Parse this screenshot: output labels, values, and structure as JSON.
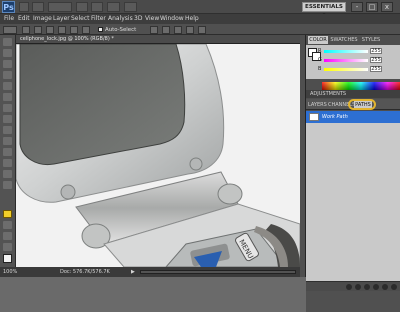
{
  "app": {
    "logo_text": "Ps",
    "workspace_label": "ESSENTIALS ▾",
    "window_controls": [
      "-",
      "□",
      "x"
    ]
  },
  "menu": [
    "File",
    "Edit",
    "Image",
    "Layer",
    "Select",
    "Filter",
    "Analysis",
    "3D",
    "View",
    "Window",
    "Help"
  ],
  "options_bar": {
    "auto_select_label": "Auto-Select"
  },
  "document": {
    "tab_title": "cellphone_lock.jpg @ 100% (RGB/8) *"
  },
  "status_bar": {
    "zoom": "100%",
    "doc_info": "Doc: 576.7K/576.7K",
    "nav_arrow": "▶"
  },
  "panels": {
    "color_tabs": [
      "COLOR",
      "SWATCHES",
      "STYLES"
    ],
    "color_values": [
      {
        "label": "R",
        "value": "255"
      },
      {
        "label": "G",
        "value": "255"
      },
      {
        "label": "B",
        "value": "255"
      }
    ],
    "adjustments_label": "ADJUSTMENTS",
    "layer_tabs": [
      "LAYERS",
      "CHANNELS",
      "PATHS"
    ],
    "active_tab_index": 2,
    "work_path_name": "Work Path"
  },
  "colors": {
    "accent": "#2d6fd2",
    "highlight_circle": "#e2b430"
  }
}
